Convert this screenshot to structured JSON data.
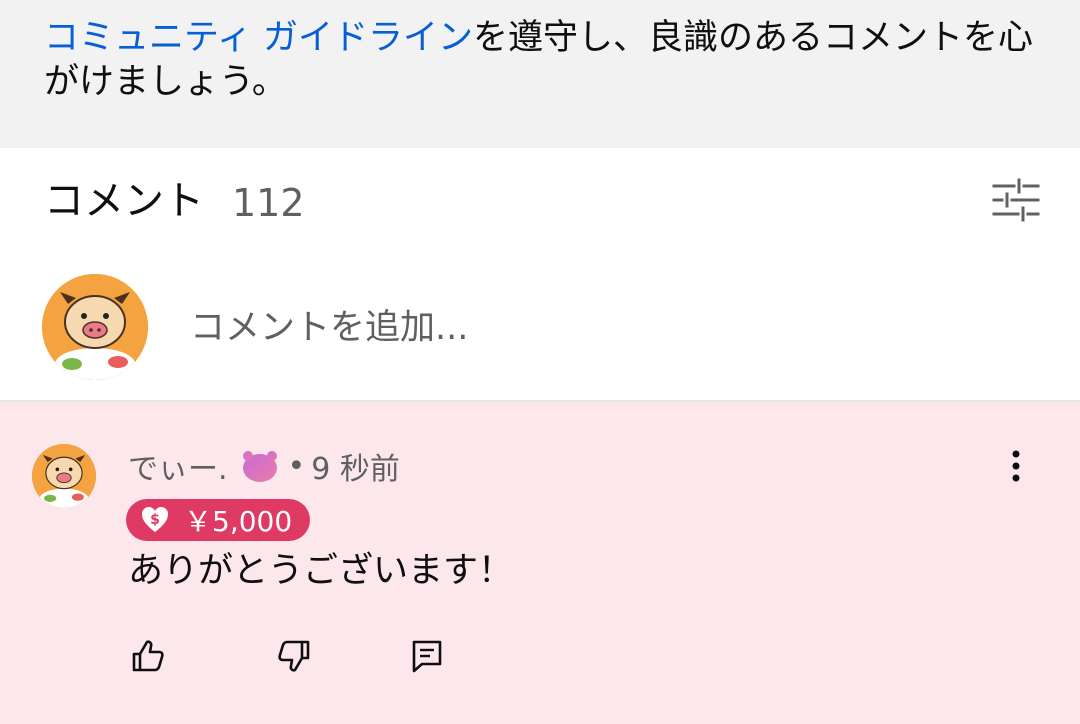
{
  "notice": {
    "link_text": "コミュニティ ガイドライン",
    "rest_text": "を遵守し、良識のあるコメントを心がけましょう。"
  },
  "comments_header": {
    "title": "コメント",
    "count": "112",
    "sort_icon": "sort-sliders-icon"
  },
  "add_comment": {
    "placeholder": "コメントを追加..."
  },
  "comment": {
    "author": "でぃー.",
    "separator": "•",
    "time": "9 秒前",
    "thanks_amount": "￥5,000",
    "body": "ありがとうございます！",
    "icons": {
      "like": "thumbs-up-icon",
      "dislike": "thumbs-down-icon",
      "reply": "reply-icon",
      "more": "more-vertical-icon"
    }
  },
  "colors": {
    "link": "#065fd4",
    "comment_highlight_bg": "#fce8ec",
    "thanks_chip": "#de3a64",
    "notice_bg": "#f2f2f2"
  }
}
